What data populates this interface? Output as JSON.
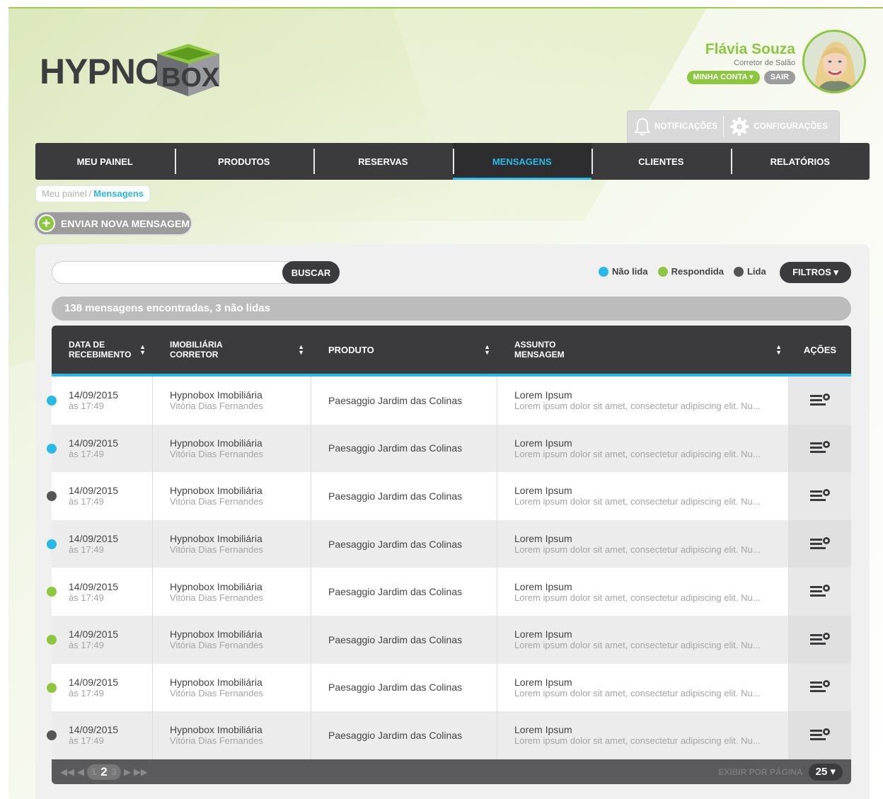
{
  "brand": {
    "logo_left": "HYPNO",
    "logo_right": "BOX"
  },
  "user": {
    "name": "Flávia Souza",
    "role": "Corretor de Salão",
    "my_account": "MINHA CONTA ▾",
    "logout": "SAIR"
  },
  "tools": {
    "notifications": "NOTIFICAÇÕES",
    "settings": "CONFIGURAÇÕES"
  },
  "nav": {
    "items": [
      {
        "label": "MEU PAINEL"
      },
      {
        "label": "PRODUTOS"
      },
      {
        "label": "RESERVAS"
      },
      {
        "label": "MENSAGENS"
      },
      {
        "label": "CLIENTES"
      },
      {
        "label": "RELATÓRIOS"
      }
    ],
    "active": "MENSAGENS"
  },
  "breadcrumb": {
    "root": "Meu painel",
    "sep": "/",
    "current": "Mensagens"
  },
  "new_message": {
    "label": "ENVIAR NOVA MENSAGEM"
  },
  "search": {
    "value": "",
    "placeholder": "",
    "button": "BUSCAR"
  },
  "legend": [
    {
      "label": "Não lida",
      "color": "#29b9e6"
    },
    {
      "label": "Respondida",
      "color": "#8dc63f"
    },
    {
      "label": "Lida",
      "color": "#555557"
    }
  ],
  "filters": {
    "label": "FILTROS ▾"
  },
  "summary": "138 mensagens encontradas, 3 não lidas",
  "table": {
    "headers": {
      "date_line1": "DATA DE",
      "date_line2": "RECEBIMENTO",
      "agency_line1": "IMOBILIÁRIA",
      "agency_line2": "CORRETOR",
      "product": "PRODUTO",
      "subject_line1": "ASSUNTO",
      "subject_line2": "MENSAGEM",
      "actions": "AÇÕES"
    },
    "rows": [
      {
        "status_color": "#29b9e6",
        "date": "14/09/2015",
        "time": "às 17:49",
        "agency": "Hypnobox Imobiliária",
        "broker": "Vitória Dias Fernandes",
        "product": "Paesaggio Jardim das Colinas",
        "subject": "Lorem Ipsum",
        "message": "Lorem ipsum dolor sit amet, consectetur adipiscing elit. Nu..."
      },
      {
        "status_color": "#29b9e6",
        "date": "14/09/2015",
        "time": "às 17:49",
        "agency": "Hypnobox Imobiliária",
        "broker": "Vitória Dias Fernandes",
        "product": "Paesaggio Jardim das Colinas",
        "subject": "Lorem Ipsum",
        "message": "Lorem ipsum dolor sit amet, consectetur adipiscing elit. Nu..."
      },
      {
        "status_color": "#555557",
        "date": "14/09/2015",
        "time": "às 17:49",
        "agency": "Hypnobox Imobiliária",
        "broker": "Vitória Dias Fernandes",
        "product": "Paesaggio Jardim das Colinas",
        "subject": "Lorem Ipsum",
        "message": "Lorem ipsum dolor sit amet, consectetur adipiscing elit. Nu..."
      },
      {
        "status_color": "#29b9e6",
        "date": "14/09/2015",
        "time": "às 17:49",
        "agency": "Hypnobox Imobiliária",
        "broker": "Vitória Dias Fernandes",
        "product": "Paesaggio Jardim das Colinas",
        "subject": "Lorem Ipsum",
        "message": "Lorem ipsum dolor sit amet, consectetur adipiscing elit. Nu..."
      },
      {
        "status_color": "#8dc63f",
        "date": "14/09/2015",
        "time": "às 17:49",
        "agency": "Hypnobox Imobiliária",
        "broker": "Vitória Dias Fernandes",
        "product": "Paesaggio Jardim das Colinas",
        "subject": "Lorem Ipsum",
        "message": "Lorem ipsum dolor sit amet, consectetur adipiscing elit. Nu..."
      },
      {
        "status_color": "#8dc63f",
        "date": "14/09/2015",
        "time": "às 17:49",
        "agency": "Hypnobox Imobiliária",
        "broker": "Vitória Dias Fernandes",
        "product": "Paesaggio Jardim das Colinas",
        "subject": "Lorem Ipsum",
        "message": "Lorem ipsum dolor sit amet, consectetur adipiscing elit. Nu..."
      },
      {
        "status_color": "#8dc63f",
        "date": "14/09/2015",
        "time": "às 17:49",
        "agency": "Hypnobox Imobiliária",
        "broker": "Vitória Dias Fernandes",
        "product": "Paesaggio Jardim das Colinas",
        "subject": "Lorem Ipsum",
        "message": "Lorem ipsum dolor sit amet, consectetur adipiscing elit. Nu..."
      },
      {
        "status_color": "#555557",
        "date": "14/09/2015",
        "time": "às 17:49",
        "agency": "Hypnobox Imobiliária",
        "broker": "Vitória Dias Fernandes",
        "product": "Paesaggio Jardim das Colinas",
        "subject": "Lorem Ipsum",
        "message": "Lorem ipsum dolor sit amet, consectetur adipiscing elit. Nu..."
      }
    ]
  },
  "pagination": {
    "first": "◀◀",
    "prev": "◀",
    "pages": [
      "1",
      "2",
      "3"
    ],
    "current": "2",
    "next": "▶",
    "last": "▶▶",
    "per_page_label": "EXIBIR POR PÁGINA",
    "per_page": "25 ▾"
  },
  "colors": {
    "accent_blue": "#29b9e6",
    "accent_green": "#8dc63f",
    "dark": "#3b3b3d"
  },
  "icons": {
    "action": "list-settings-icon",
    "notifications": "bell-icon",
    "settings": "gear-icon",
    "sort": "sort-arrows-icon"
  }
}
